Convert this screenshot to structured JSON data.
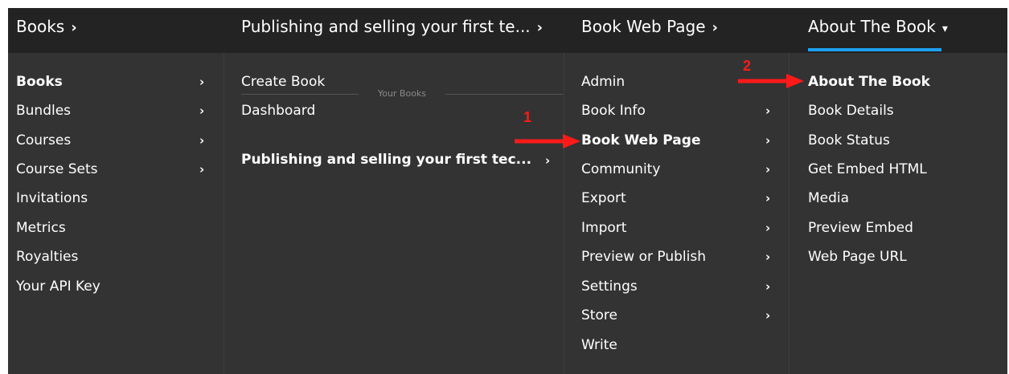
{
  "breadcrumb": {
    "items": [
      {
        "label": "Books"
      },
      {
        "label": "Publishing and selling your first te..."
      },
      {
        "label": "Book Web Page"
      },
      {
        "label": "About The Book"
      }
    ]
  },
  "col1": {
    "items": [
      {
        "label": "Books",
        "has_arrow": true,
        "bold": true
      },
      {
        "label": "Bundles",
        "has_arrow": true
      },
      {
        "label": "Courses",
        "has_arrow": true
      },
      {
        "label": "Course Sets",
        "has_arrow": true
      },
      {
        "label": "Invitations"
      },
      {
        "label": "Metrics"
      },
      {
        "label": "Royalties"
      },
      {
        "label": "Your API Key"
      }
    ]
  },
  "col2": {
    "items": [
      {
        "label": "Create Book"
      },
      {
        "label": "Dashboard"
      }
    ],
    "section_label": "Your Books",
    "book_item": "Publishing and selling your first tec..."
  },
  "col3": {
    "items": [
      {
        "label": "Admin"
      },
      {
        "label": "Book Info",
        "has_arrow": true
      },
      {
        "label": "Book Web Page",
        "has_arrow": true,
        "bold": true
      },
      {
        "label": "Community",
        "has_arrow": true
      },
      {
        "label": "Export",
        "has_arrow": true
      },
      {
        "label": "Import",
        "has_arrow": true
      },
      {
        "label": "Preview or Publish",
        "has_arrow": true
      },
      {
        "label": "Settings",
        "has_arrow": true
      },
      {
        "label": "Store",
        "has_arrow": true
      },
      {
        "label": "Write"
      }
    ]
  },
  "col4": {
    "items": [
      {
        "label": "About The Book",
        "bold": true
      },
      {
        "label": "Book Details"
      },
      {
        "label": "Book Status"
      },
      {
        "label": "Get Embed HTML"
      },
      {
        "label": "Media"
      },
      {
        "label": "Preview Embed"
      },
      {
        "label": "Web Page URL"
      }
    ]
  },
  "annotations": {
    "marker1": "1",
    "marker2": "2",
    "arrow_color": "#ff1a1a"
  },
  "colors": {
    "accent": "#1da1f2",
    "topbar": "#232323",
    "panel": "#333333"
  }
}
